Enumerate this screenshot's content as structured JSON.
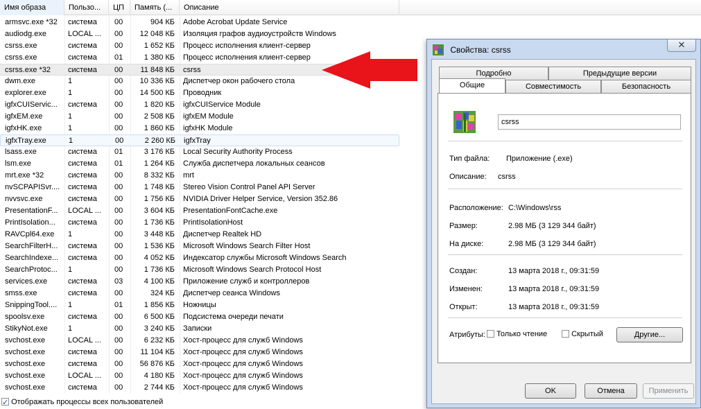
{
  "task_manager": {
    "columns": [
      "Имя образа",
      "Пользо...",
      "ЦП",
      "Память (...",
      "Описание"
    ],
    "rows": [
      {
        "name": "armsvc.exe *32",
        "user": "система",
        "cpu": "00",
        "mem": "904 КБ",
        "desc": "Adobe Acrobat Update Service"
      },
      {
        "name": "audiodg.exe",
        "user": "LOCAL ...",
        "cpu": "00",
        "mem": "12 048 КБ",
        "desc": "Изоляция графов аудиоустройств Windows"
      },
      {
        "name": "csrss.exe",
        "user": "система",
        "cpu": "00",
        "mem": "1 652 КБ",
        "desc": "Процесс исполнения клиент-сервер"
      },
      {
        "name": "csrss.exe",
        "user": "система",
        "cpu": "01",
        "mem": "1 380 КБ",
        "desc": "Процесс исполнения клиент-сервер"
      },
      {
        "name": "csrss.exe *32",
        "user": "система",
        "cpu": "00",
        "mem": "11 848 КБ",
        "desc": "csrss"
      },
      {
        "name": "dwm.exe",
        "user": "1",
        "cpu": "00",
        "mem": "10 336 КБ",
        "desc": "Диспетчер окон рабочего стола"
      },
      {
        "name": "explorer.exe",
        "user": "1",
        "cpu": "00",
        "mem": "14 500 КБ",
        "desc": "Проводник"
      },
      {
        "name": "igfxCUIServic...",
        "user": "система",
        "cpu": "00",
        "mem": "1 820 КБ",
        "desc": "igfxCUIService Module"
      },
      {
        "name": "igfxEM.exe",
        "user": "1",
        "cpu": "00",
        "mem": "2 508 КБ",
        "desc": "igfxEM Module"
      },
      {
        "name": "igfxHK.exe",
        "user": "1",
        "cpu": "00",
        "mem": "1 860 КБ",
        "desc": "igfxHK Module"
      },
      {
        "name": "igfxTray.exe",
        "user": "1",
        "cpu": "00",
        "mem": "2 260 КБ",
        "desc": "igfxTray"
      },
      {
        "name": "lsass.exe",
        "user": "система",
        "cpu": "01",
        "mem": "3 176 КБ",
        "desc": "Local Security Authority Process"
      },
      {
        "name": "lsm.exe",
        "user": "система",
        "cpu": "01",
        "mem": "1 264 КБ",
        "desc": "Служба диспетчера локальных сеансов"
      },
      {
        "name": "mrt.exe *32",
        "user": "система",
        "cpu": "00",
        "mem": "8 332 КБ",
        "desc": "mrt"
      },
      {
        "name": "nvSCPAPISvr....",
        "user": "система",
        "cpu": "00",
        "mem": "1 748 КБ",
        "desc": "Stereo Vision Control Panel API Server"
      },
      {
        "name": "nvvsvc.exe",
        "user": "система",
        "cpu": "00",
        "mem": "1 756 КБ",
        "desc": "NVIDIA Driver Helper Service, Version 352.86"
      },
      {
        "name": "PresentationF...",
        "user": "LOCAL ...",
        "cpu": "00",
        "mem": "3 604 КБ",
        "desc": "PresentationFontCache.exe"
      },
      {
        "name": "PrintIsolation...",
        "user": "система",
        "cpu": "00",
        "mem": "1 736 КБ",
        "desc": "PrintIsolationHost"
      },
      {
        "name": "RAVCpl64.exe",
        "user": "1",
        "cpu": "00",
        "mem": "3 448 КБ",
        "desc": "Диспетчер Realtek HD"
      },
      {
        "name": "SearchFilterH...",
        "user": "система",
        "cpu": "00",
        "mem": "1 536 КБ",
        "desc": "Microsoft Windows Search Filter Host"
      },
      {
        "name": "SearchIndexe...",
        "user": "система",
        "cpu": "00",
        "mem": "4 052 КБ",
        "desc": "Индексатор службы Microsoft Windows Search"
      },
      {
        "name": "SearchProtoc...",
        "user": "1",
        "cpu": "00",
        "mem": "1 736 КБ",
        "desc": "Microsoft Windows Search Protocol Host"
      },
      {
        "name": "services.exe",
        "user": "система",
        "cpu": "03",
        "mem": "4 100 КБ",
        "desc": "Приложение служб и контроллеров"
      },
      {
        "name": "smss.exe",
        "user": "система",
        "cpu": "00",
        "mem": "324 КБ",
        "desc": "Диспетчер сеанса  Windows"
      },
      {
        "name": "SnippingTool....",
        "user": "1",
        "cpu": "01",
        "mem": "1 856 КБ",
        "desc": "Ножницы"
      },
      {
        "name": "spoolsv.exe",
        "user": "система",
        "cpu": "00",
        "mem": "6 500 КБ",
        "desc": "Подсистема очереди печати"
      },
      {
        "name": "StikyNot.exe",
        "user": "1",
        "cpu": "00",
        "mem": "3 240 КБ",
        "desc": "Записки"
      },
      {
        "name": "svchost.exe",
        "user": "LOCAL ...",
        "cpu": "00",
        "mem": "6 232 КБ",
        "desc": "Хост-процесс для служб Windows"
      },
      {
        "name": "svchost.exe",
        "user": "система",
        "cpu": "00",
        "mem": "11 104 КБ",
        "desc": "Хост-процесс для служб Windows"
      },
      {
        "name": "svchost.exe",
        "user": "система",
        "cpu": "00",
        "mem": "56 876 КБ",
        "desc": "Хост-процесс для служб Windows"
      },
      {
        "name": "svchost.exe",
        "user": "LOCAL ...",
        "cpu": "00",
        "mem": "4 180 КБ",
        "desc": "Хост-процесс для служб Windows"
      },
      {
        "name": "svchost.exe",
        "user": "система",
        "cpu": "00",
        "mem": "2 744 КБ",
        "desc": "Хост-процесс для служб Windows"
      }
    ],
    "selected_row": 4,
    "hover_row": 10,
    "show_all_users": {
      "label": "Отображать процессы всех пользователей",
      "checked": true
    }
  },
  "dialog": {
    "title": "Свойства: csrss",
    "close_glyph": "✕",
    "tabs_back": [
      "Подробно",
      "Предыдущие версии"
    ],
    "tabs_front": [
      "Общие",
      "Совместимость",
      "Безопасность"
    ],
    "active_tab": "Общие",
    "file_name": "csrss",
    "file_type_label": "Тип файла:",
    "file_type_value": "Приложение (.exe)",
    "description_label": "Описание:",
    "description_value": "csrss",
    "location_label": "Расположение:",
    "location_value": "C:\\Windows\\rss",
    "size_label": "Размер:",
    "size_value": "2.98 МБ (3 129 344 байт)",
    "disk_label": "На диске:",
    "disk_value": "2.98 МБ (3 129 344 байт)",
    "created_label": "Создан:",
    "created_value": "13 марта 2018 г., 09:31:59",
    "modified_label": "Изменен:",
    "modified_value": "13 марта 2018 г., 09:31:59",
    "opened_label": "Открыт:",
    "opened_value": "13 марта 2018 г., 09:31:59",
    "attributes_label": "Атрибуты:",
    "readonly_label": "Только чтение",
    "hidden_label": "Скрытый",
    "other_button": "Другие...",
    "ok_button": "OK",
    "cancel_button": "Отмена",
    "apply_button": "Применить"
  },
  "colors": {
    "arrow": "#e8141a",
    "dialog_frame": "#c9daf0"
  }
}
